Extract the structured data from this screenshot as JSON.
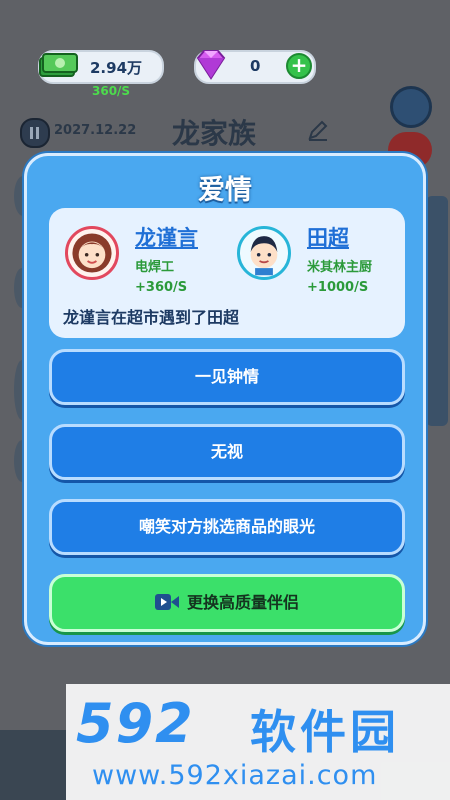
{
  "top_bar": {
    "money_value": "2.94万",
    "money_rate": "360/S",
    "gem_value": "0",
    "gem_add_symbol": "+"
  },
  "header": {
    "date": "2027.12.22",
    "family_name": "龙家族"
  },
  "modal": {
    "title": "爱情",
    "person_a": {
      "name": "龙谨言",
      "job": "电焊工",
      "rate": "+360/S"
    },
    "person_b": {
      "name": "田超",
      "job": "米其林主厨",
      "rate": "+1000/S"
    },
    "event_text": "龙谨言在超市遇到了田超",
    "options": [
      "一见钟情",
      "无视",
      "嘲笑对方挑选商品的眼光"
    ],
    "ad_option": "更换高质量伴侣"
  },
  "watermark": {
    "logo_num": "592",
    "logo_cn": "软件园",
    "url": "www.592xiazai.com"
  },
  "icons": {
    "money": "money-stack-icon",
    "gem": "gem-icon",
    "plus": "plus-icon",
    "pause": "pause-icon",
    "edit": "pencil-icon",
    "settings": "gear-icon",
    "video": "video-icon"
  },
  "colors": {
    "modal_bg": "#4aa8f0",
    "option_button": "#1f7ee6",
    "ad_button": "#3be06a",
    "name_link": "#1f6fd6",
    "income_green": "#2b9a3a"
  }
}
